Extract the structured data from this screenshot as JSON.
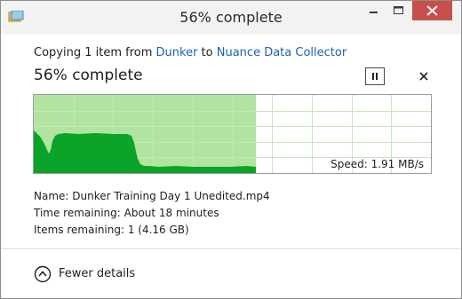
{
  "window": {
    "title": "56% complete"
  },
  "copy": {
    "prefix": "Copying 1 item from ",
    "source": "Dunker",
    "joiner": " to ",
    "destination": "Nuance Data Collector"
  },
  "progress": {
    "heading": "56% complete",
    "fraction": 0.56
  },
  "speed": {
    "label": "Speed: 1.91 MB/s"
  },
  "details": {
    "name": "Name: Dunker Training Day 1 Unedited.mp4",
    "time_remaining": "Time remaining: About 18 minutes",
    "items_remaining": "Items remaining: 1 (4.16 GB)"
  },
  "toggle": {
    "label": "Fewer details"
  },
  "icons": {
    "title": "file-copy-icon",
    "pause": "pause-icon",
    "cancel": "close-icon",
    "toggle": "chevron-up-circle-icon"
  },
  "colors": {
    "progress_fill": "#b1e4a0",
    "speed_area": "#0aa528",
    "grid": "#c6e6bc",
    "close_button": "#c7504b"
  }
}
